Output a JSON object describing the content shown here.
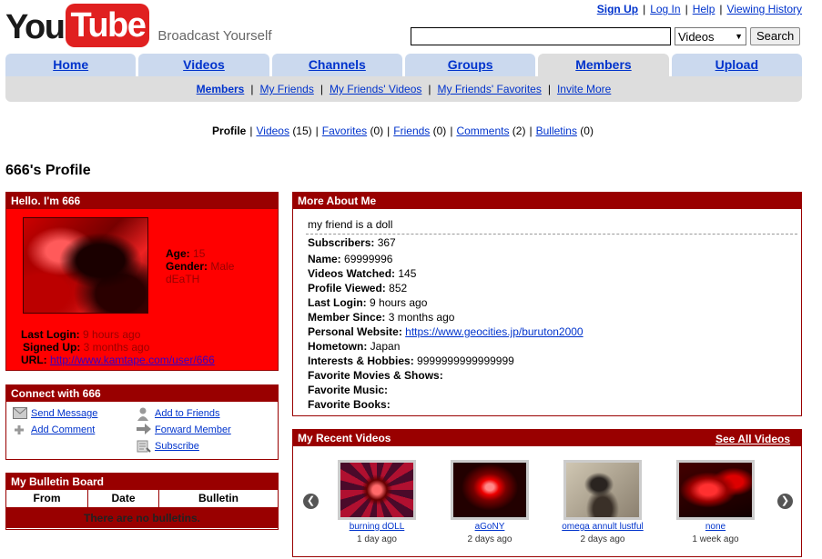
{
  "header": {
    "logo_you": "You",
    "logo_tube": "Tube",
    "tagline": "Broadcast Yourself",
    "links": [
      "Sign Up",
      "Log In",
      "Help",
      "Viewing History"
    ],
    "search_select": "Videos",
    "search_button": "Search",
    "search_value": ""
  },
  "tabs": [
    {
      "label": "Home",
      "active": false
    },
    {
      "label": "Videos",
      "active": false
    },
    {
      "label": "Channels",
      "active": false
    },
    {
      "label": "Groups",
      "active": false
    },
    {
      "label": "Members",
      "active": true
    },
    {
      "label": "Upload",
      "active": false
    }
  ],
  "subnav": [
    "Members",
    "My Friends",
    "My Friends' Videos",
    "My Friends' Favorites",
    "Invite More"
  ],
  "profile_nav": {
    "current": "Profile",
    "items": [
      {
        "label": "Videos",
        "count": "(15)"
      },
      {
        "label": "Favorites",
        "count": "(0)"
      },
      {
        "label": "Friends",
        "count": "(0)"
      },
      {
        "label": "Comments",
        "count": "(2)"
      },
      {
        "label": "Bulletins",
        "count": "(0)"
      }
    ]
  },
  "page_title": "666's Profile",
  "hello": {
    "title": "Hello. I'm 666",
    "age_label": "Age:",
    "age": "15",
    "gender_label": "Gender:",
    "gender": "Male",
    "tagline": "dEaTH",
    "last_login_label": "Last Login:",
    "last_login": "9 hours ago",
    "signed_up_label": "Signed Up:",
    "signed_up": "3 months ago",
    "url_label": "URL:",
    "url": "http://www.kamtape.com/user/666"
  },
  "connect": {
    "title": "Connect with",
    "name": "666",
    "actions": [
      "Send Message",
      "Add Comment",
      "Add to Friends",
      "Forward Member",
      "Subscribe"
    ]
  },
  "bulletin": {
    "title": "My Bulletin Board",
    "columns": [
      "From",
      "Date",
      "Bulletin"
    ],
    "empty": "There are no bulletins."
  },
  "more": {
    "title": "More About Me",
    "intro": "my friend is a doll",
    "rows": [
      {
        "label": "Subscribers:",
        "value": "367"
      },
      {
        "label": "Name:",
        "value": "69999996"
      },
      {
        "label": "Videos Watched:",
        "value": "145"
      },
      {
        "label": "Profile Viewed:",
        "value": "852"
      },
      {
        "label": "Last Login:",
        "value": "9 hours ago"
      },
      {
        "label": "Member Since:",
        "value": "3 months ago"
      },
      {
        "label": "Personal Website:",
        "value": "https://www.geocities.jp/buruton2000"
      },
      {
        "label": "Hometown:",
        "value": "Japan"
      },
      {
        "label": "Interests & Hobbies:",
        "value": "9999999999999999"
      },
      {
        "label": "Favorite Movies & Shows:",
        "value": ""
      },
      {
        "label": "Favorite Music:",
        "value": ""
      },
      {
        "label": "Favorite Books:",
        "value": ""
      }
    ]
  },
  "recent": {
    "title": "My Recent Videos",
    "see_all": "See All Videos",
    "videos": [
      {
        "title": "burning dOLL",
        "age": "1 day ago"
      },
      {
        "title": "aGoNY",
        "age": "2 days ago"
      },
      {
        "title": "omega annult lustful",
        "age": "2 days ago"
      },
      {
        "title": "none",
        "age": "1 week ago"
      }
    ]
  }
}
